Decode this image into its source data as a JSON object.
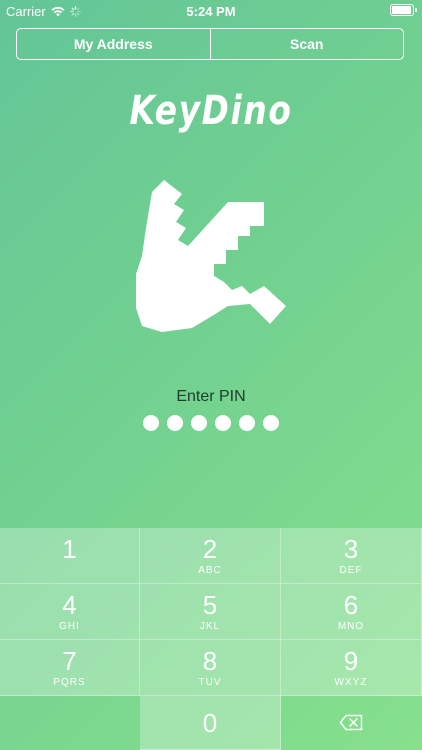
{
  "status_bar": {
    "carrier": "Carrier",
    "time": "5:24 PM"
  },
  "tabs": [
    {
      "label": "My Address"
    },
    {
      "label": "Scan"
    }
  ],
  "app_title": "KeyDino",
  "pin": {
    "label": "Enter PIN",
    "dot_count": 6
  },
  "keypad": [
    {
      "num": "1",
      "letters": ""
    },
    {
      "num": "2",
      "letters": "ABC"
    },
    {
      "num": "3",
      "letters": "DEF"
    },
    {
      "num": "4",
      "letters": "GHI"
    },
    {
      "num": "5",
      "letters": "JKL"
    },
    {
      "num": "6",
      "letters": "MNO"
    },
    {
      "num": "7",
      "letters": "PQRS"
    },
    {
      "num": "8",
      "letters": "TUV"
    },
    {
      "num": "9",
      "letters": "WXYZ"
    },
    {
      "num": "0",
      "letters": ""
    }
  ],
  "icons": {
    "wifi": "wifi-icon",
    "activity": "activity-spinner-icon",
    "battery": "battery-icon",
    "logo": "dino-key-logo",
    "delete": "backspace-icon"
  },
  "colors": {
    "gradient_start": "#63c597",
    "gradient_end": "#86e08c",
    "pin_label": "#1f3b2c"
  }
}
